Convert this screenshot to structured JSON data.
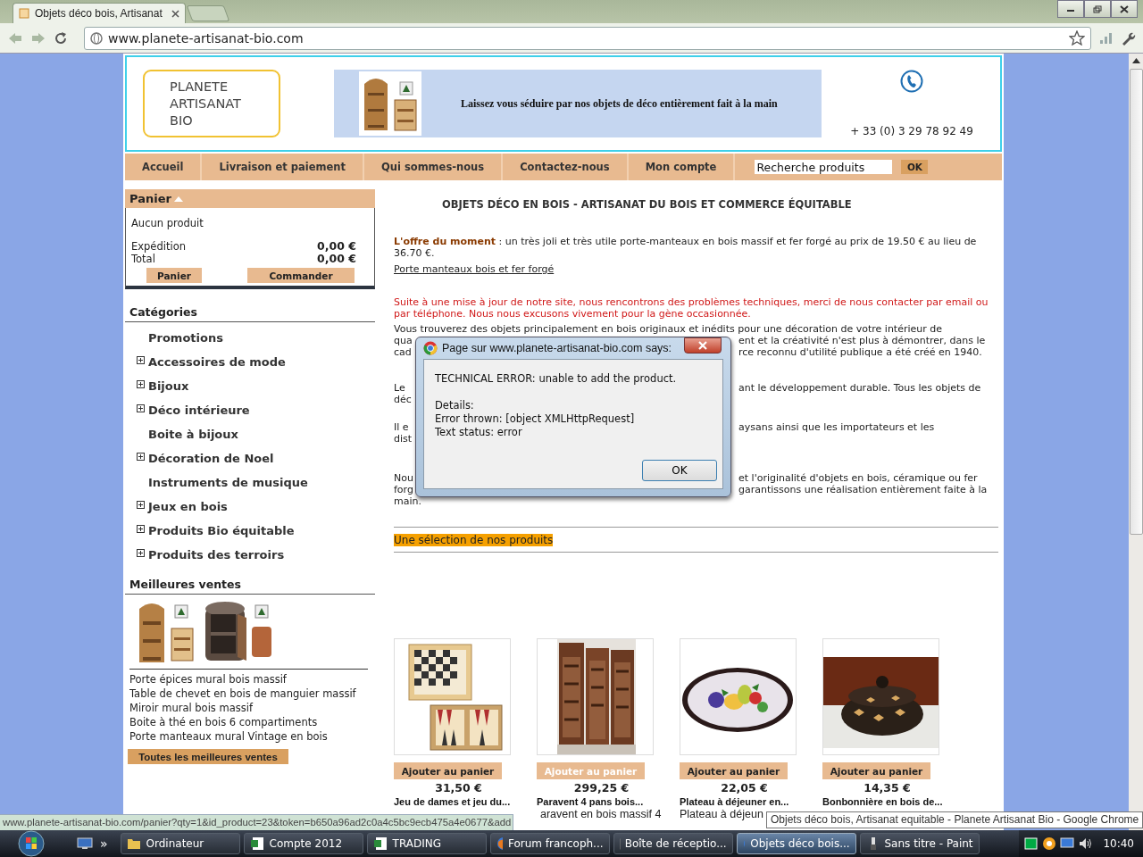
{
  "browser": {
    "tabs": [
      {
        "title": "Objets déco bois, Artisanat",
        "selected": true
      }
    ],
    "address": "www.planete-artisanat-bio.com"
  },
  "header": {
    "logo": [
      "PLANETE",
      "ARTISANAT",
      "BIO"
    ],
    "banner_text": "Laissez vous séduire par nos objets de déco entièrement fait à la main",
    "phone": "+ 33 (0) 3 29 78 92 49"
  },
  "nav": {
    "items": [
      "Accueil",
      "Livraison et paiement",
      "Qui sommes-nous",
      "Contactez-nous",
      "Mon compte"
    ],
    "search": {
      "value": "Recherche produits"
    },
    "search_button": "OK"
  },
  "cart": {
    "title": "Panier",
    "empty": "Aucun produit",
    "rows": [
      {
        "label": "Expédition",
        "value": "0,00 €"
      },
      {
        "label": "Total",
        "value": "0,00 €"
      }
    ],
    "buttons": [
      "Panier",
      "Commander"
    ]
  },
  "categories": {
    "title": "Catégories",
    "items": [
      {
        "label": "Promotions",
        "expandable": false
      },
      {
        "label": "Accessoires de mode",
        "expandable": true
      },
      {
        "label": "Bijoux",
        "expandable": true
      },
      {
        "label": "Déco intérieure",
        "expandable": true
      },
      {
        "label": "Boite à bijoux",
        "expandable": false
      },
      {
        "label": "Décoration de Noel",
        "expandable": true
      },
      {
        "label": "Instruments de musique",
        "expandable": false
      },
      {
        "label": "Jeux en bois",
        "expandable": true
      },
      {
        "label": "Produits Bio équitable",
        "expandable": true
      },
      {
        "label": "Produits des terroirs",
        "expandable": true
      }
    ]
  },
  "bestsellers": {
    "title": "Meilleures ventes",
    "items": [
      "Porte épices mural bois massif",
      "Table de chevet en bois de manguier massif",
      "Miroir mural bois massif",
      "Boite à thé en bois 6 compartiments",
      "Porte manteaux mural Vintage en bois"
    ],
    "button": "Toutes les meilleures ventes"
  },
  "main": {
    "title": "OBJETS DÉCO EN BOIS - ARTISANAT DU BOIS ET COMMERCE ÉQUITABLE",
    "offer": "**L'offre du moment** : un très joli et très utile porte-manteaux en bois massif et fer forgé au prix de 19.50 € au lieu de 36.70 €.",
    "offer_link": "Porte manteaux bois et fer forgé",
    "notice": "Suite à une mise à jour de notre site, nous rencontrons des problèmes techniques, merci de nous contacter par email ou par téléphone. Nous nous excusons vivement pour la gène occasionnée.",
    "paragraphs": [
      {
        "lines": [
          {
            "left": "Vous trouverez des objets principalement en bois originaux et inédits pour une décoration de votre intérieur de"
          },
          {
            "left": "qua",
            "right": "ent et la créativité n'est plus à démontrer, dans le"
          },
          {
            "left": "cad",
            "right": "rce reconnu d'utilité publique a été créé en 1940."
          }
        ]
      },
      {
        "lines": [
          {
            "left": "Le",
            "right": "ant le développement durable.  Tous les objets de"
          },
          {
            "left": "déc"
          }
        ]
      },
      {
        "lines": [
          {
            "left": "Il e",
            "right": "aysans ainsi que les importateurs et les"
          },
          {
            "left": "dist"
          }
        ]
      },
      {
        "lines": [
          {
            "left": "Nou",
            "right": "et l'originalité d'objets en bois, céramique ou fer"
          },
          {
            "left": "forg",
            "right": "garantissons une réalisation entièrement faite à la"
          },
          {
            "left": "main."
          }
        ]
      }
    ],
    "section_title": "Une sélection de nos produits",
    "products": [
      {
        "button": "Ajouter au panier",
        "disabled": false,
        "price": "31,50 €",
        "name": "Jeu de dames et jeu du..."
      },
      {
        "button": "Ajouter au panier",
        "disabled": true,
        "price": "299,25 €",
        "name": "Paravent 4 pans bois...",
        "description": "aravent en bois massif 4"
      },
      {
        "button": "Ajouter au panier",
        "disabled": false,
        "price": "22,05 €",
        "name": "Plateau à déjeuner en...",
        "description": "Plateau à déjeun"
      },
      {
        "button": "Ajouter au panier",
        "disabled": false,
        "price": "14,35 €",
        "name": "Bonbonnière en bois de..."
      }
    ]
  },
  "dialog": {
    "title": "Page sur www.planete-artisanat-bio.com says:",
    "message": "TECHNICAL ERROR: unable to add the product.",
    "details": [
      "Details:",
      "Error thrown: [object XMLHttpRequest]",
      "Text status: error"
    ],
    "button": "OK"
  },
  "status_url": "www.planete-artisanat-bio.com/panier?qty=1&id_product=23&token=b650a96ad2c0a4c5bc9ecb475a4e0677&add",
  "tooltip": "Objets déco bois, Artisanat equitable - Planete Artisanat Bio - Google Chrome",
  "taskbar": {
    "overflow": "»",
    "items": [
      {
        "label": "Ordinateur",
        "kind": "folder",
        "selected": false
      },
      {
        "label": "Compte 2012",
        "kind": "sheet",
        "selected": false
      },
      {
        "label": "TRADING",
        "kind": "sheet",
        "selected": false
      },
      {
        "label": "Forum francoph...",
        "kind": "browser",
        "selected": false
      },
      {
        "label": "Boîte de réceptio...",
        "kind": "mail",
        "selected": false
      },
      {
        "label": "Objets déco bois...",
        "kind": "browser",
        "selected": true
      },
      {
        "label": "Sans titre - Paint",
        "kind": "paint",
        "selected": false
      }
    ],
    "clock": "10:40"
  }
}
